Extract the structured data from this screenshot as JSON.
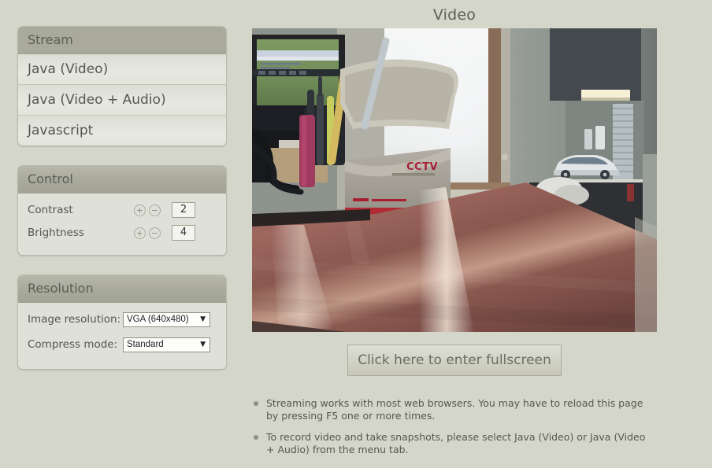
{
  "page": {
    "title": "Video",
    "background_color": "#d4d6ca"
  },
  "stream_panel": {
    "header": "Stream",
    "items": [
      {
        "label": "Java (Video)"
      },
      {
        "label": "Java (Video + Audio)"
      },
      {
        "label": "Javascript"
      }
    ]
  },
  "control_panel": {
    "header": "Control",
    "rows": [
      {
        "label": "Contrast",
        "value": "2",
        "increase_icon": "plus-circle-icon",
        "decrease_icon": "minus-circle-icon",
        "increase_label": "+",
        "decrease_label": "−"
      },
      {
        "label": "Brightness",
        "value": "4",
        "increase_icon": "plus-circle-icon",
        "decrease_icon": "minus-circle-icon",
        "increase_label": "+",
        "decrease_label": "−"
      }
    ]
  },
  "resolution_panel": {
    "header": "Resolution",
    "rows": [
      {
        "label": "Image resolution:",
        "selected": "VGA (640x480)",
        "arrow_icon": "chevron-down-icon",
        "arrow_glyph": "▼"
      },
      {
        "label": "Compress mode:",
        "selected": "Standard",
        "arrow_icon": "chevron-down-icon",
        "arrow_glyph": "▼"
      }
    ]
  },
  "video": {
    "alt": "Live camera stream showing an office desk with a monitor, a pen cup, a CCTV-branded cardboard box, a bright window, and a shelf with a white toy car",
    "fullscreen_button": "Click here to enter fullscreen"
  },
  "notes": [
    {
      "bullet_icon": "bullet-dot-icon",
      "text": "Streaming works with most web browsers. You may have to reload this page by pressing F5 one or more times."
    },
    {
      "bullet_icon": "bullet-dot-icon",
      "text": "To record video and take snapshots, please select Java (Video) or Java (Video + Audio) from the menu tab."
    }
  ]
}
